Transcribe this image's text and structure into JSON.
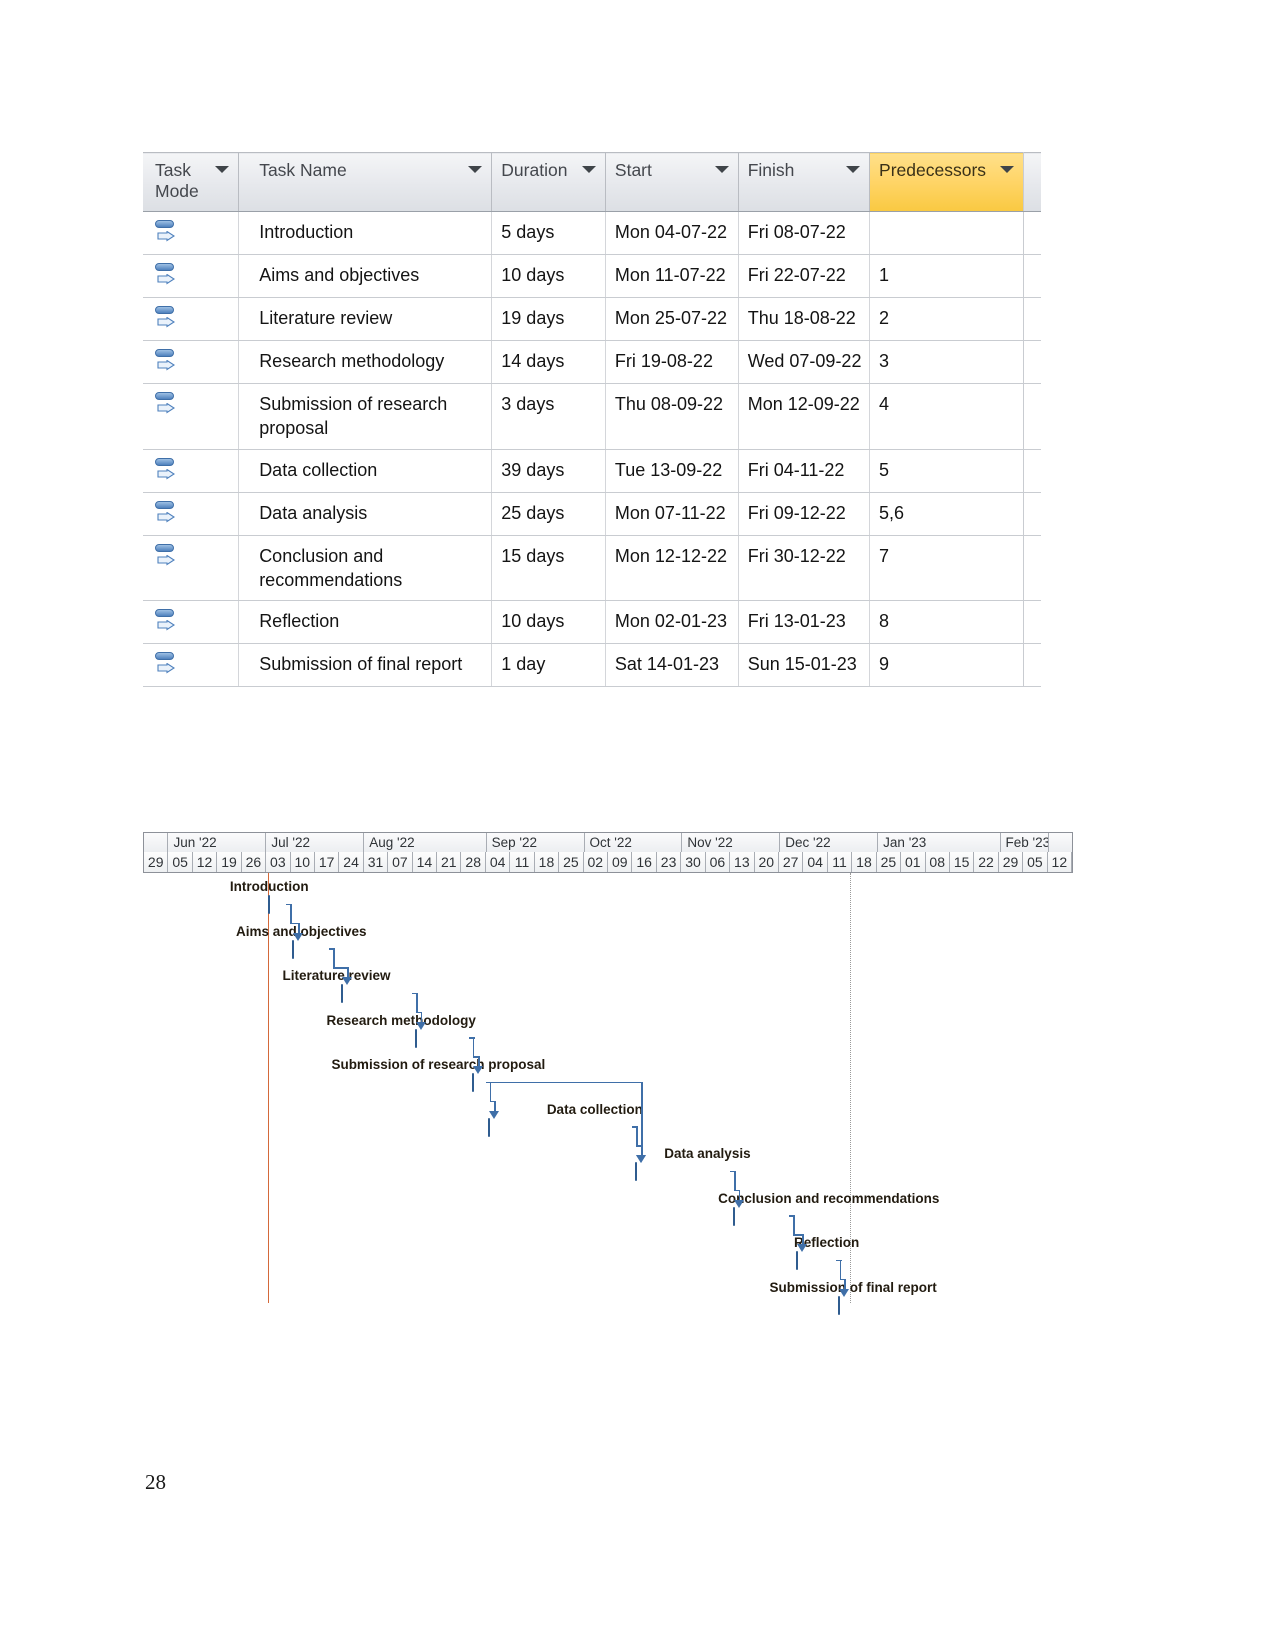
{
  "document": {
    "page_number": "28"
  },
  "task_table": {
    "columns": [
      {
        "id": "task_mode",
        "label": "Task Mode",
        "highlight": false,
        "has_filter": true
      },
      {
        "id": "task_name",
        "label": "Task Name",
        "highlight": false,
        "has_filter": true
      },
      {
        "id": "duration",
        "label": "Duration",
        "highlight": false,
        "has_filter": true
      },
      {
        "id": "start",
        "label": "Start",
        "highlight": false,
        "has_filter": true
      },
      {
        "id": "finish",
        "label": "Finish",
        "highlight": false,
        "has_filter": true
      },
      {
        "id": "predecessors",
        "label": "Predecessors",
        "highlight": true,
        "has_filter": true
      }
    ],
    "rows": [
      {
        "mode_icon": "auto-schedule-icon",
        "name": "Introduction",
        "duration": "5 days",
        "start": "Mon 04-07-22",
        "finish": "Fri 08-07-22",
        "predecessors": ""
      },
      {
        "mode_icon": "auto-schedule-icon",
        "name": "Aims and objectives",
        "duration": "10 days",
        "start": "Mon 11-07-22",
        "finish": "Fri 22-07-22",
        "predecessors": "1"
      },
      {
        "mode_icon": "auto-schedule-icon",
        "name": "Literature review",
        "duration": "19 days",
        "start": "Mon 25-07-22",
        "finish": "Thu 18-08-22",
        "predecessors": "2"
      },
      {
        "mode_icon": "auto-schedule-icon",
        "name": "Research methodology",
        "duration": "14 days",
        "start": "Fri 19-08-22",
        "finish": "Wed 07-09-22",
        "predecessors": "3"
      },
      {
        "mode_icon": "auto-schedule-icon",
        "name": "Submission of research proposal",
        "duration": "3 days",
        "start": "Thu 08-09-22",
        "finish": "Mon 12-09-22",
        "predecessors": "4"
      },
      {
        "mode_icon": "auto-schedule-icon",
        "name": "Data collection",
        "duration": "39 days",
        "start": "Tue 13-09-22",
        "finish": "Fri 04-11-22",
        "predecessors": "5"
      },
      {
        "mode_icon": "auto-schedule-icon",
        "name": "Data analysis",
        "duration": "25 days",
        "start": "Mon 07-11-22",
        "finish": "Fri 09-12-22",
        "predecessors": "5,6"
      },
      {
        "mode_icon": "auto-schedule-icon",
        "name": "Conclusion and recommendations",
        "duration": "15 days",
        "start": "Mon 12-12-22",
        "finish": "Fri 30-12-22",
        "predecessors": "7"
      },
      {
        "mode_icon": "auto-schedule-icon",
        "name": "Reflection",
        "duration": "10 days",
        "start": "Mon 02-01-23",
        "finish": "Fri 13-01-23",
        "predecessors": "8"
      },
      {
        "mode_icon": "auto-schedule-icon",
        "name": "Submission of final report",
        "duration": "1 day",
        "start": "Sat 14-01-23",
        "finish": "Sun 15-01-23",
        "predecessors": "9"
      }
    ]
  },
  "gantt": {
    "timeline": {
      "months": [
        {
          "label": "",
          "weeks": 1
        },
        {
          "label": "Jun '22",
          "weeks": 4
        },
        {
          "label": "Jul '22",
          "weeks": 4
        },
        {
          "label": "Aug '22",
          "weeks": 5
        },
        {
          "label": "Sep '22",
          "weeks": 4
        },
        {
          "label": "Oct '22",
          "weeks": 4
        },
        {
          "label": "Nov '22",
          "weeks": 4
        },
        {
          "label": "Dec '22",
          "weeks": 4
        },
        {
          "label": "Jan '23",
          "weeks": 5
        },
        {
          "label": "Feb '23",
          "weeks": 2
        }
      ],
      "weeks": [
        "29",
        "05",
        "12",
        "19",
        "26",
        "03",
        "10",
        "17",
        "24",
        "31",
        "07",
        "14",
        "21",
        "28",
        "04",
        "11",
        "18",
        "25",
        "02",
        "09",
        "16",
        "23",
        "30",
        "06",
        "13",
        "20",
        "27",
        "04",
        "11",
        "18",
        "25",
        "01",
        "08",
        "15",
        "22",
        "29",
        "05",
        "12"
      ]
    },
    "bars": [
      {
        "label": "Introduction",
        "start_week": 5.1,
        "end_week": 5.85,
        "label_week": 3.55,
        "row": 0
      },
      {
        "label": "Aims and objectives",
        "start_week": 6.1,
        "end_week": 7.6,
        "label_week": 3.8,
        "row": 1
      },
      {
        "label": "Literature review",
        "start_week": 8.1,
        "end_week": 11.0,
        "label_week": 5.7,
        "row": 2
      },
      {
        "label": "Research methodology",
        "start_week": 11.1,
        "end_week": 13.3,
        "label_week": 7.5,
        "row": 3
      },
      {
        "label": "Submission of research proposal",
        "start_week": 13.45,
        "end_week": 14.0,
        "label_week": 7.7,
        "row": 4
      },
      {
        "label": "Data collection",
        "start_week": 14.1,
        "end_week": 20.0,
        "label_week": 16.5,
        "row": 5
      },
      {
        "label": "Data analysis",
        "start_week": 20.1,
        "end_week": 24.0,
        "label_week": 21.3,
        "row": 6
      },
      {
        "label": "Conclusion and recommendations",
        "start_week": 24.1,
        "end_week": 26.4,
        "label_week": 23.5,
        "row": 7
      },
      {
        "label": "Reflection",
        "start_week": 26.7,
        "end_week": 28.3,
        "label_week": 26.6,
        "row": 8
      },
      {
        "label": "Submission of final report",
        "start_week": 28.4,
        "end_week": 28.7,
        "label_week": 25.6,
        "row": 9
      }
    ],
    "today_marker_week": 28.9,
    "project_start_marker_week": 5.1
  }
}
